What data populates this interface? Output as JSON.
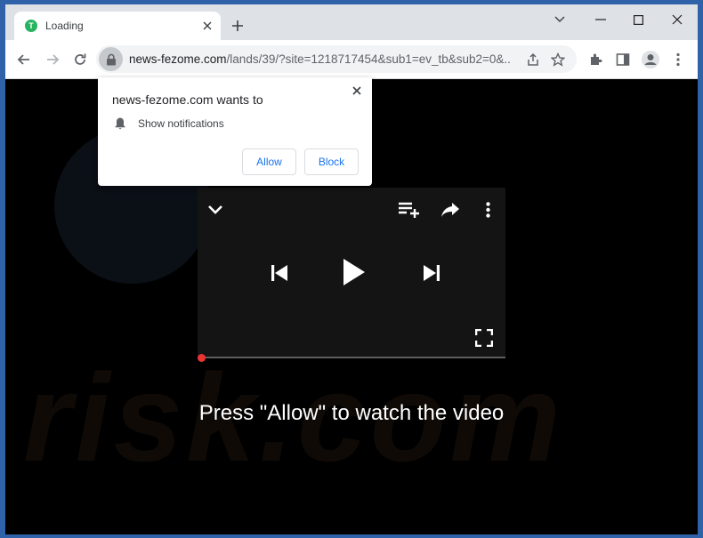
{
  "tab": {
    "title": "Loading",
    "favicon_letter": "T"
  },
  "address_bar": {
    "host": "news-fezome.com",
    "path": "/lands/39/?site=1218717454&sub1=ev_tb&sub2=0&..."
  },
  "notification_popup": {
    "title": "news-fezome.com wants to",
    "permission": "Show notifications",
    "allow_label": "Allow",
    "block_label": "Block"
  },
  "page": {
    "caption": "Press \"Allow\" to watch the video",
    "watermark": "risk.com"
  },
  "video_player": {
    "progress": 0
  },
  "colors": {
    "frame": "#2f62a8",
    "accent_link": "#1a73e8",
    "progress_dot": "#ee3333",
    "favicon": "#27b35f"
  }
}
